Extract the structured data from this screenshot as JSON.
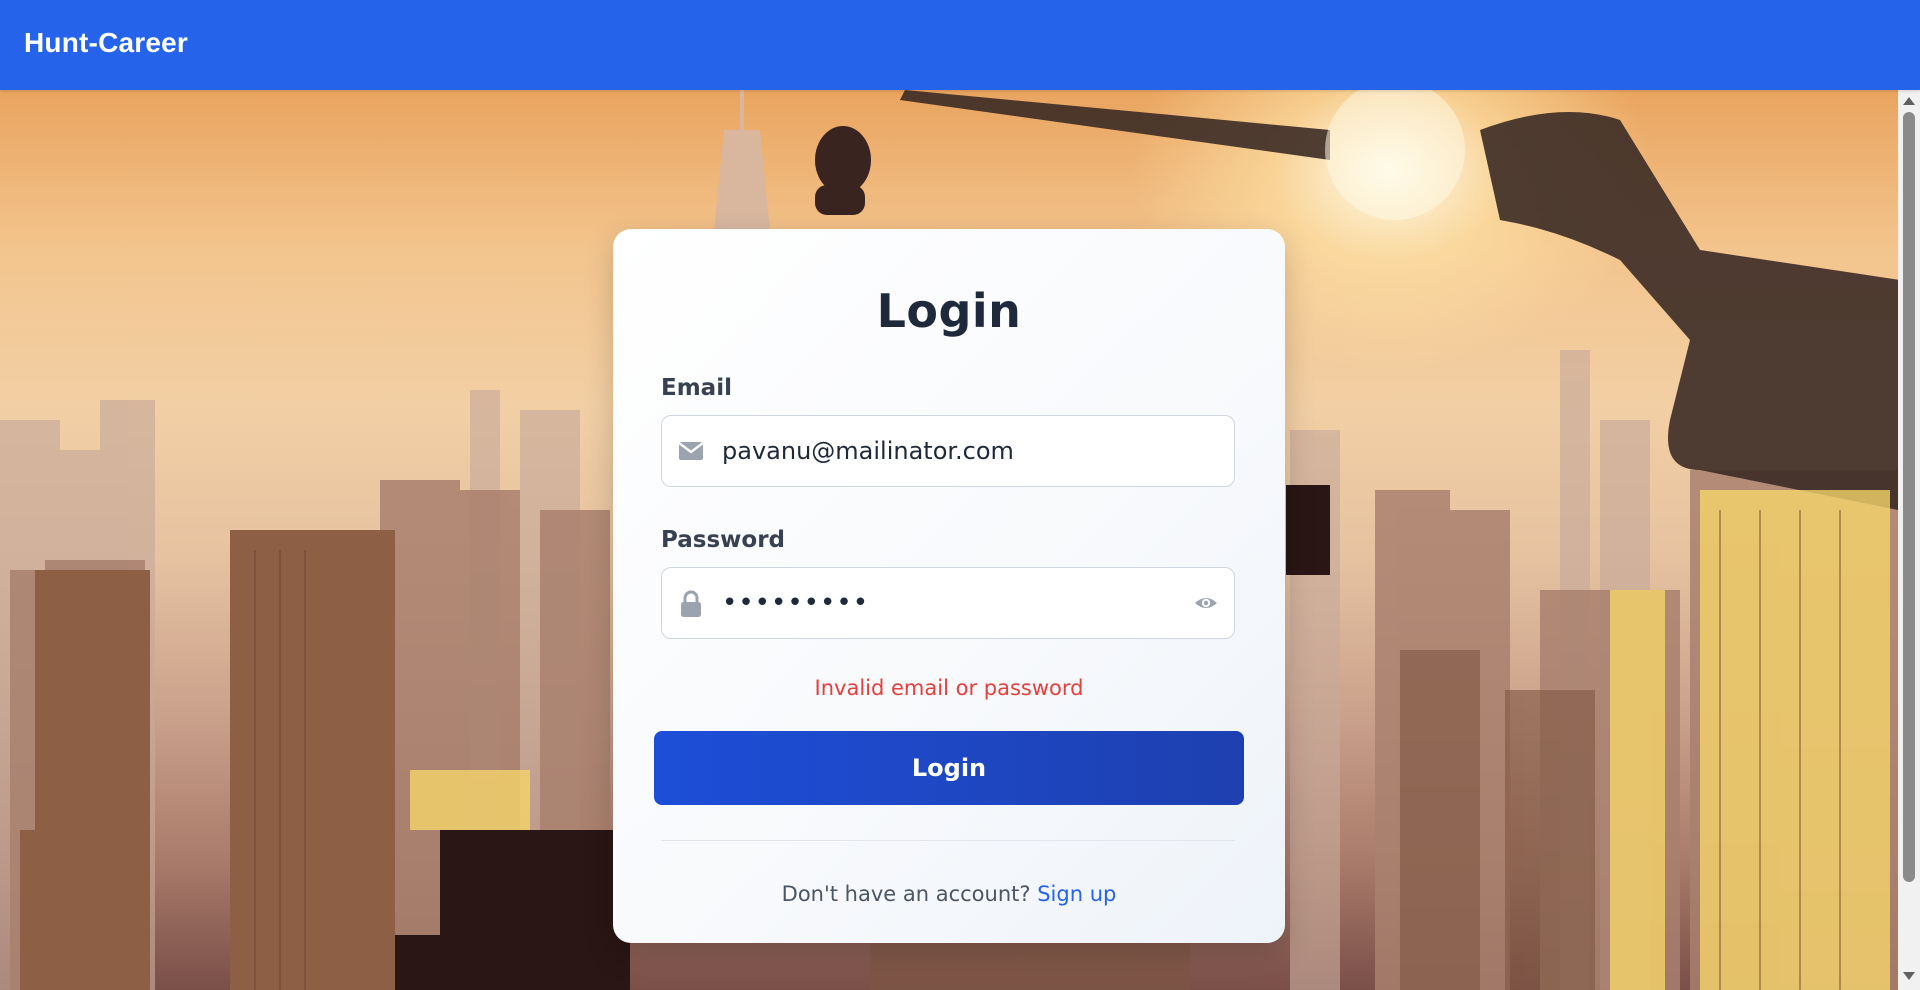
{
  "app": {
    "brand": "Hunt-Career"
  },
  "login": {
    "title": "Login",
    "email_label": "Email",
    "email_value": "pavanu@mailinator.com",
    "password_label": "Password",
    "password_value": "•••••••••",
    "error_message": "Invalid email or password",
    "submit_label": "Login",
    "no_account_text": "Don't have an account?",
    "signup_link": "Sign up"
  },
  "icons": {
    "email": "envelope-icon",
    "password": "lock-icon",
    "toggle_password": "eye-icon"
  },
  "colors": {
    "navbar": "#2563eb",
    "button": "#1d4ed8",
    "error": "#e53e3e",
    "link": "#2563eb",
    "title": "#1e293b"
  }
}
